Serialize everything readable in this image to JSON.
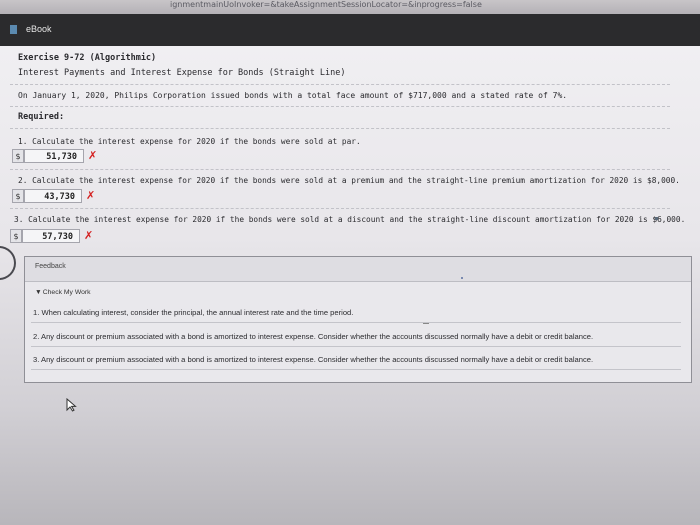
{
  "browser": {
    "url_fragment": "ignmentmainUoInvoker=&takeAssignmentSessionLocator=&inprogress=false"
  },
  "titlebar": {
    "ebook_label": "eBook"
  },
  "exercise": {
    "title": "Exercise 9-72 (Algorithmic)",
    "subtitle": "Interest Payments and Interest Expense for Bonds (Straight Line)",
    "intro": "On January 1, 2020, Philips Corporation issued bonds with a total face amount of $717,000 and a stated rate of 7%.",
    "required_label": "Required:"
  },
  "questions": [
    {
      "text": "1.  Calculate the interest expense for 2020 if the bonds were sold at par.",
      "currency": "$",
      "answer": "51,730",
      "mark": "✗"
    },
    {
      "text": "2.  Calculate the interest expense for 2020 if the bonds were sold at a premium and the straight-line premium amortization for 2020 is $8,000.",
      "currency": "$",
      "answer": "43,730",
      "mark": "✗"
    },
    {
      "text": "3.  Calculate the interest expense for 2020 if the bonds were sold at a discount and the straight-line discount amortization for 2020 is $6,000.",
      "currency": "$",
      "answer": "57,730",
      "mark": "✗"
    }
  ],
  "feedback": {
    "label": "Feedback",
    "toggle_glyph": "▼",
    "check_my_work": "Check My Work",
    "items": [
      "1. When calculating interest, consider the principal, the annual interest rate and the time period.",
      "2. Any discount or premium associated with a bond is amortized to interest expense. Consider whether the accounts discussed normally have a debit or credit balance.",
      "3. Any discount or premium associated with a bond is amortized to interest expense. Consider whether the accounts discussed normally have a debit or credit balance."
    ]
  },
  "colors": {
    "incorrect": "#d42020",
    "titlebar_bg": "#2b2b2d"
  },
  "icons": {
    "ebook": "ebook-icon",
    "incorrect": "x-mark-icon",
    "cursor": "mouse-cursor-icon"
  }
}
